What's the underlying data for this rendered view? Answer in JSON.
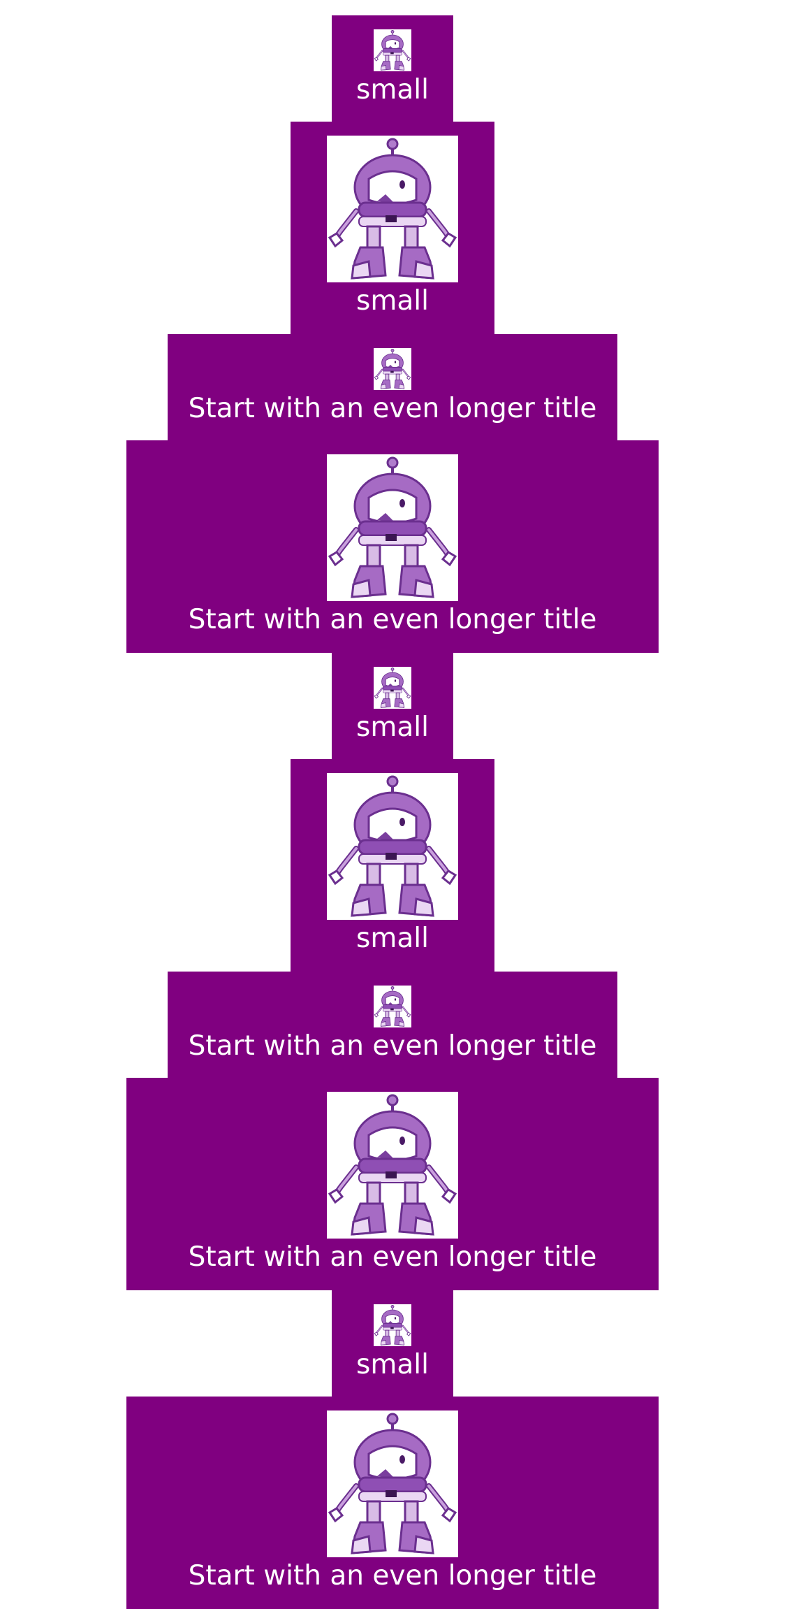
{
  "cards": [
    {
      "title": "small",
      "image": "robot-mascot-icon"
    },
    {
      "title": "small",
      "image": "robot-mascot-icon"
    },
    {
      "title": "Start with an even longer title",
      "image": "robot-mascot-icon"
    },
    {
      "title": "Start with an even longer title",
      "image": "robot-mascot-icon"
    },
    {
      "title": "small",
      "image": "robot-mascot-icon"
    },
    {
      "title": "small",
      "image": "robot-mascot-icon"
    },
    {
      "title": "Start with an even longer title",
      "image": "robot-mascot-icon"
    },
    {
      "title": "Start with an even longer title",
      "image": "robot-mascot-icon"
    },
    {
      "title": "small",
      "image": "robot-mascot-icon"
    },
    {
      "title": "Start with an even longer title",
      "image": "robot-mascot-icon"
    }
  ],
  "colors": {
    "card_background": "#800080",
    "page_background": "#ffffff",
    "title_text": "#ffffff"
  }
}
